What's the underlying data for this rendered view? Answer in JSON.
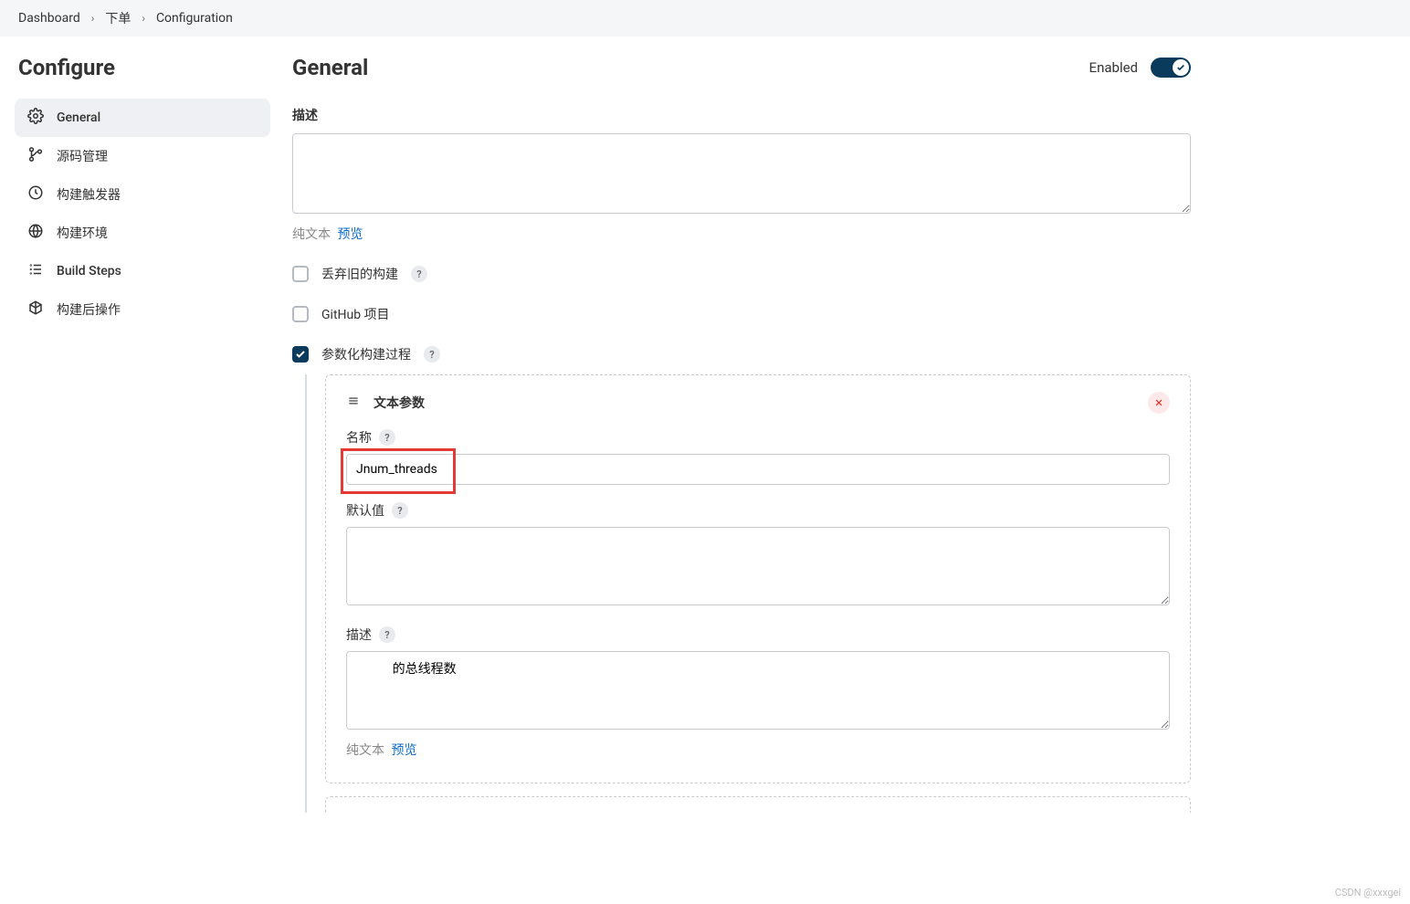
{
  "breadcrumb": {
    "items": [
      "Dashboard",
      "下单",
      "Configuration"
    ]
  },
  "sidebar": {
    "title": "Configure",
    "items": [
      {
        "label": "General"
      },
      {
        "label": "源码管理"
      },
      {
        "label": "构建触发器"
      },
      {
        "label": "构建环境"
      },
      {
        "label": "Build Steps"
      },
      {
        "label": "构建后操作"
      }
    ]
  },
  "header": {
    "title": "General",
    "enabled_label": "Enabled"
  },
  "description": {
    "label": "描述",
    "value": "",
    "plain": "纯文本",
    "preview": "预览"
  },
  "checkboxes": {
    "discard_label": "丢弃旧的构建",
    "github_label": "GitHub 项目",
    "parameterized_label": "参数化构建过程"
  },
  "param": {
    "type_label": "文本参数",
    "name_label": "名称",
    "name_value": "Jnum_threads",
    "default_label": "默认值",
    "default_value": "",
    "desc_label": "描述",
    "desc_value": "            的总线程数",
    "plain": "纯文本",
    "preview": "预览"
  },
  "help_glyph": "?",
  "watermark": "CSDN @xxxgei"
}
